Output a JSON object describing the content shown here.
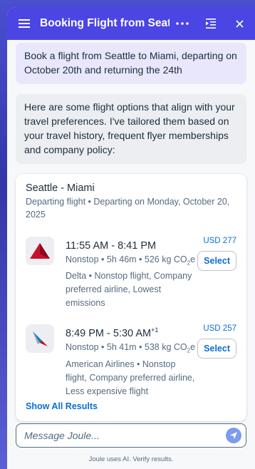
{
  "header": {
    "title": "Booking Flight from Seattle to ...",
    "menu_icon": "hamburger-icon",
    "more_icon": "more-icon",
    "expand_icon": "expand-panel-icon",
    "close_icon": "close-icon"
  },
  "messages": {
    "user": "Book a flight from Seattle to Miami, departing on October 20th and returning the 24th",
    "bot": "Here are some flight options that align with your travel preferences. I've tailored them based on your travel history, frequent flyer memberships and company policy:"
  },
  "card": {
    "route": "Seattle - Miami",
    "subtitle": "Departing flight • Departing on Monday, October 20, 2025",
    "flights": [
      {
        "airline_logo": "delta-logo",
        "time": "11:55 AM - 8:41 PM",
        "time_suffix": "",
        "meta_prefix": "Nonstop • 5h 46m • 526 kg CO",
        "meta_sub": "2",
        "meta_suffix": "e",
        "description": "Delta • Nonstop flight, Company preferred airline, Lowest emissions",
        "price": "USD 277",
        "select_label": "Select"
      },
      {
        "airline_logo": "american-airlines-logo",
        "time": "8:49 PM - 5:30 AM",
        "time_suffix": "+1",
        "meta_prefix": "Nonstop • 5h 41m • 538 kg CO",
        "meta_sub": "2",
        "meta_suffix": "e",
        "description": "American Airlines • Nonstop flight, Company preferred airline, Less expensive flight",
        "price": "USD 257",
        "select_label": "Select"
      }
    ],
    "show_all": "Show All Results"
  },
  "composer": {
    "placeholder": "Message Joule...",
    "send_icon": "send-icon"
  },
  "footer": "Joule uses AI. Verify results.",
  "colors": {
    "header_bg": "#4b45e4",
    "accent": "#0a6ed1",
    "user_bubble": "#e8e7fb",
    "bot_bubble": "#eceef1"
  }
}
